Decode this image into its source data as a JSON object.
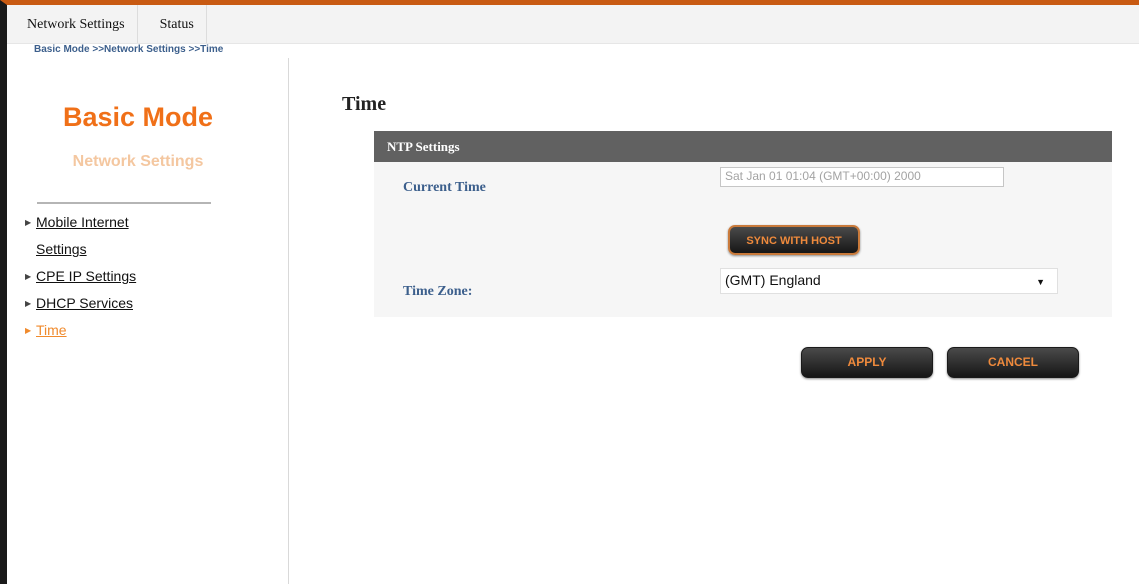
{
  "nav": {
    "tabs": [
      "Network Settings",
      "Status"
    ],
    "breadcrumb": "Basic Mode >>Network Settings >>Time"
  },
  "sidebar": {
    "title": "Basic Mode",
    "subtitle": "Network Settings",
    "items": [
      {
        "label_line1": "Mobile Internet",
        "label_line2": "Settings",
        "active": false
      },
      {
        "label": "CPE IP Settings",
        "active": false
      },
      {
        "label": "DHCP Services",
        "active": false
      },
      {
        "label": "Time",
        "active": true
      }
    ]
  },
  "main": {
    "title": "Time",
    "panel": {
      "header": "NTP Settings",
      "current_time_label": "Current Time",
      "current_time_value": "Sat Jan 01 01:04 (GMT+00:00) 2000",
      "sync_button": "SYNC WITH HOST",
      "time_zone_label": "Time Zone:",
      "time_zone_value": "(GMT) England"
    },
    "apply_button": "APPLY",
    "cancel_button": "CANCEL"
  },
  "colors": {
    "accent": "#f07018",
    "link_blue": "#3c5f8c",
    "header_gray": "#616161"
  }
}
